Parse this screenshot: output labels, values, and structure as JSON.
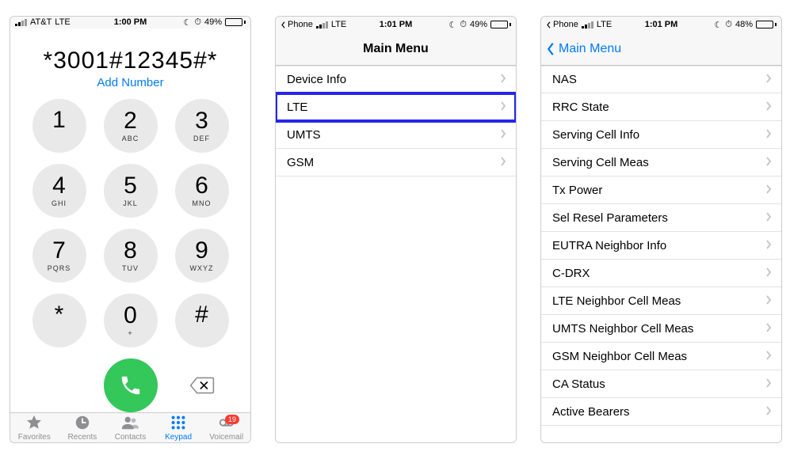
{
  "screen1": {
    "status": {
      "carrier": "AT&T",
      "network": "LTE",
      "time": "1:00 PM",
      "battery_percent": "49%"
    },
    "display": "*3001#12345#*",
    "add_number": "Add Number",
    "keys": [
      {
        "digit": "1",
        "letters": ""
      },
      {
        "digit": "2",
        "letters": "ABC"
      },
      {
        "digit": "3",
        "letters": "DEF"
      },
      {
        "digit": "4",
        "letters": "GHI"
      },
      {
        "digit": "5",
        "letters": "JKL"
      },
      {
        "digit": "6",
        "letters": "MNO"
      },
      {
        "digit": "7",
        "letters": "PQRS"
      },
      {
        "digit": "8",
        "letters": "TUV"
      },
      {
        "digit": "9",
        "letters": "WXYZ"
      },
      {
        "digit": "*",
        "letters": ""
      },
      {
        "digit": "0",
        "letters": "+"
      },
      {
        "digit": "#",
        "letters": ""
      }
    ],
    "tabs": {
      "favorites": "Favorites",
      "recents": "Recents",
      "contacts": "Contacts",
      "keypad": "Keypad",
      "voicemail": "Voicemail",
      "voicemail_badge": "19"
    }
  },
  "screen2": {
    "status": {
      "back_app": "Phone",
      "network": "LTE",
      "time": "1:01 PM",
      "battery_percent": "49%"
    },
    "title": "Main Menu",
    "items": [
      {
        "label": "Device Info",
        "highlight": false
      },
      {
        "label": "LTE",
        "highlight": true
      },
      {
        "label": "UMTS",
        "highlight": false
      },
      {
        "label": "GSM",
        "highlight": false
      }
    ]
  },
  "screen3": {
    "status": {
      "back_app": "Phone",
      "network": "LTE",
      "time": "1:01 PM",
      "battery_percent": "48%"
    },
    "back_label": "Main Menu",
    "items": [
      "NAS",
      "RRC State",
      "Serving Cell Info",
      "Serving Cell Meas",
      "Tx Power",
      "Sel Resel Parameters",
      "EUTRA Neighbor Info",
      "C-DRX",
      "LTE Neighbor Cell Meas",
      "UMTS Neighbor Cell Meas",
      "GSM Neighbor Cell Meas",
      "CA Status",
      "Active Bearers"
    ]
  }
}
